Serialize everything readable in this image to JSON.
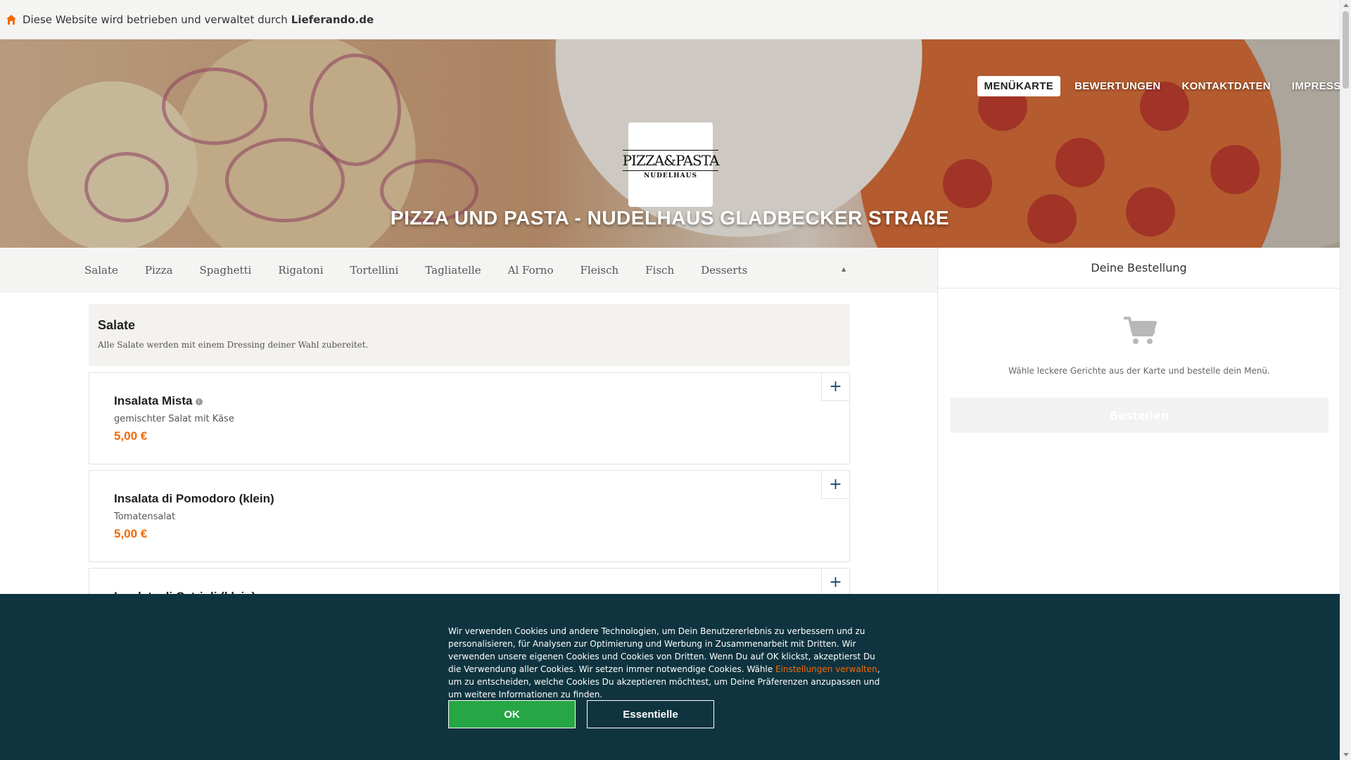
{
  "topbar": {
    "text": "Diese Website wird betrieben und verwaltet durch",
    "brand": "Lieferando.de",
    "icon": "home-icon",
    "icon_color": "#f36805"
  },
  "nav": {
    "items": [
      "MENÜKARTE",
      "BEWERTUNGEN",
      "KONTAKTDATEN",
      "IMPRESSUM"
    ],
    "active_index": 0
  },
  "logo": {
    "line1": "PIZZA&PASTA",
    "line2": "NUDELHAUS"
  },
  "restaurant_title": "PIZZA UND PASTA - NUDELHAUS GLADBECKER STRAßE",
  "categories": {
    "items": [
      "Salate",
      "Pizza",
      "Spaghetti",
      "Rigatoni",
      "Tortellini",
      "Tagliatelle",
      "Al Forno",
      "Fleisch",
      "Fisch",
      "Desserts"
    ],
    "more_icon": "more-icon"
  },
  "section": {
    "title": "Salate",
    "description": "Alle Salate werden mit einem Dressing deiner Wahl zubereitet."
  },
  "menu_items": [
    {
      "name": "Insalata Mista",
      "has_info": true,
      "description": "gemischter Salat mit Käse",
      "price": "5,00 €"
    },
    {
      "name": "Insalata di Pomodoro (klein)",
      "has_info": false,
      "description": "Tomatensalat",
      "price": "5,00 €"
    },
    {
      "name": "Insalata di Cetrioli (klein)",
      "has_info": false,
      "description": "",
      "price": ""
    }
  ],
  "add_label": "+",
  "info_glyph": "i",
  "basket": {
    "title": "Deine Bestellung",
    "empty_hint": "Wähle leckere Gerichte aus der Karte und bestelle dein Menü.",
    "order_button": "Bestellen",
    "icon": "cart-icon"
  },
  "cookie": {
    "text_before": "Wir verwenden Cookies und andere Technologien, um Dein Benutzererlebnis zu verbessern und zu personalisieren, für Analysen zur Optimierung und Werbung in Zusammenarbeit mit Dritten. Wir verwenden unsere eigenen Cookies und Cookies von Dritten. Wenn Du auf OK klickst, akzeptierst Du die Verwendung aller Cookies. Wir setzen immer notwendige Cookies. Wähle ",
    "link": "Einstellungen verwalten",
    "text_after": ", um zu entscheiden, welche Cookies Du akzeptieren möchtest, um Deine Präferenzen anzupassen und um weitere Informationen zu finden.",
    "ok_label": "OK",
    "essential_label": "Essentielle",
    "background": "#0f3440",
    "ok_color": "#26a644",
    "link_color": "#f36805"
  },
  "colors": {
    "price": "#f36805",
    "accent": "#1a4a73"
  }
}
